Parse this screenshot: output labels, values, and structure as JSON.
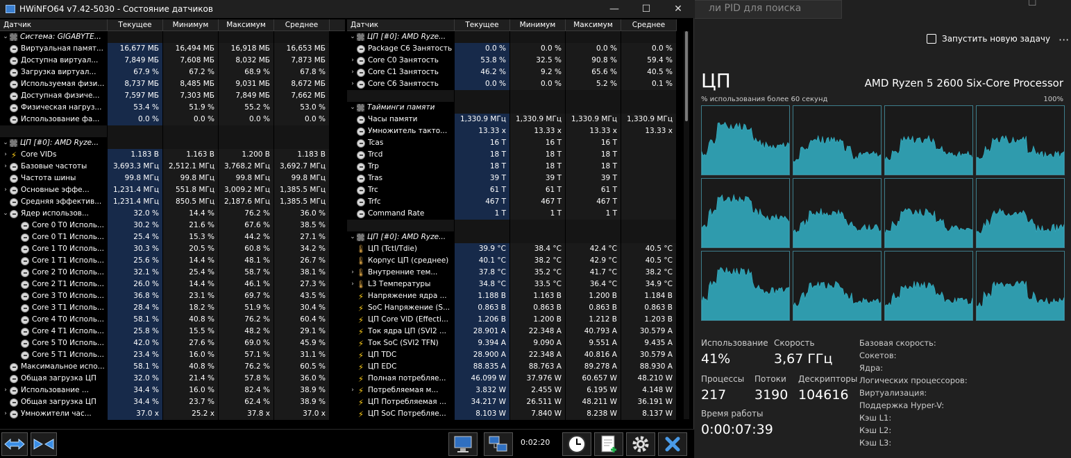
{
  "hwinfo": {
    "title": "HWiNFO64 v7.42-5030 - Состояние датчиков",
    "controls": {
      "minimize": "—",
      "maximize": "☐",
      "close": "✕"
    },
    "columns": [
      "Датчик",
      "Текущее",
      "Минимум",
      "Максимум",
      "Среднее"
    ],
    "left_rows": [
      {
        "kind": "group",
        "arrow": "v",
        "icon": "chip",
        "name": "Система: GIGABYTE...",
        "v": [
          "",
          "",
          "",
          ""
        ]
      },
      {
        "kind": "row",
        "arrow": "",
        "icon": "sensor",
        "indent": 0,
        "name": "Виртуальная памят...",
        "v": [
          "16,677 МБ",
          "16,494 МБ",
          "16,918 МБ",
          "16,653 МБ"
        ]
      },
      {
        "kind": "row",
        "arrow": "",
        "icon": "sensor",
        "indent": 0,
        "name": "Доступна виртуал...",
        "v": [
          "7,849 МБ",
          "7,608 МБ",
          "8,032 МБ",
          "7,873 МБ"
        ]
      },
      {
        "kind": "row",
        "arrow": "",
        "icon": "sensor",
        "indent": 0,
        "name": "Загрузка виртуал...",
        "v": [
          "67.9 %",
          "67.2 %",
          "68.9 %",
          "67.8 %"
        ]
      },
      {
        "kind": "row",
        "arrow": "",
        "icon": "sensor",
        "indent": 0,
        "name": "Используемая физи...",
        "v": [
          "8,737 МБ",
          "8,485 МБ",
          "9,031 МБ",
          "8,672 МБ"
        ]
      },
      {
        "kind": "row",
        "arrow": "",
        "icon": "sensor",
        "indent": 0,
        "name": "Доступная физиче...",
        "v": [
          "7,597 МБ",
          "7,303 МБ",
          "7,849 МБ",
          "7,662 МБ"
        ]
      },
      {
        "kind": "row",
        "arrow": "",
        "icon": "sensor",
        "indent": 0,
        "name": "Физическая нагруз...",
        "v": [
          "53.4 %",
          "51.9 %",
          "55.2 %",
          "53.0 %"
        ]
      },
      {
        "kind": "row",
        "arrow": "",
        "icon": "sensor",
        "indent": 0,
        "name": "Использование фа...",
        "v": [
          "0.0 %",
          "0.0 %",
          "0.0 %",
          "0.0 %"
        ]
      },
      {
        "kind": "sep"
      },
      {
        "kind": "group",
        "arrow": "v",
        "icon": "chip",
        "name": "ЦП [#0]: AMD Ryze...",
        "v": [
          "",
          "",
          "",
          ""
        ]
      },
      {
        "kind": "row",
        "arrow": ">",
        "icon": "bolt",
        "indent": 0,
        "name": "Core VIDs",
        "v": [
          "1.183 В",
          "1.163 В",
          "1.200 В",
          "1.183 В"
        ]
      },
      {
        "kind": "row",
        "arrow": ">",
        "icon": "sensor",
        "indent": 0,
        "name": "Базовые частоты",
        "v": [
          "3,693.3 МГц",
          "2,512.1 МГц",
          "3,768.2 МГц",
          "3,692.7 МГц"
        ]
      },
      {
        "kind": "row",
        "arrow": "",
        "icon": "sensor",
        "indent": 0,
        "name": "Частота шины",
        "v": [
          "99.8 МГц",
          "99.8 МГц",
          "99.8 МГц",
          "99.8 МГц"
        ]
      },
      {
        "kind": "row",
        "arrow": ">",
        "icon": "sensor",
        "indent": 0,
        "name": "Основные эффе...",
        "v": [
          "1,231.4 МГц",
          "551.8 МГц",
          "3,009.2 МГц",
          "1,385.5 МГц"
        ]
      },
      {
        "kind": "row",
        "arrow": "",
        "icon": "sensor",
        "indent": 0,
        "name": "Средняя эффектив...",
        "v": [
          "1,231.4 МГц",
          "850.5 МГц",
          "2,187.6 МГц",
          "1,385.5 МГц"
        ]
      },
      {
        "kind": "row",
        "arrow": "v",
        "icon": "sensor",
        "indent": 0,
        "name": "Ядер использов...",
        "v": [
          "32.0 %",
          "14.4 %",
          "76.2 %",
          "36.0 %"
        ]
      },
      {
        "kind": "row",
        "arrow": "",
        "icon": "sensor",
        "indent": 1,
        "name": "Core 0 T0 Исполь...",
        "v": [
          "30.2 %",
          "21.6 %",
          "67.6 %",
          "38.5 %"
        ]
      },
      {
        "kind": "row",
        "arrow": "",
        "icon": "sensor",
        "indent": 1,
        "name": "Core 0 T1 Исполь...",
        "v": [
          "25.4 %",
          "15.3 %",
          "44.2 %",
          "27.1 %"
        ]
      },
      {
        "kind": "row",
        "arrow": "",
        "icon": "sensor",
        "indent": 1,
        "name": "Core 1 T0 Исполь...",
        "v": [
          "30.3 %",
          "20.5 %",
          "60.8 %",
          "34.2 %"
        ]
      },
      {
        "kind": "row",
        "arrow": "",
        "icon": "sensor",
        "indent": 1,
        "name": "Core 1 T1 Исполь...",
        "v": [
          "25.6 %",
          "14.4 %",
          "48.1 %",
          "26.7 %"
        ]
      },
      {
        "kind": "row",
        "arrow": "",
        "icon": "sensor",
        "indent": 1,
        "name": "Core 2 T0 Исполь...",
        "v": [
          "32.1 %",
          "25.4 %",
          "58.7 %",
          "38.1 %"
        ]
      },
      {
        "kind": "row",
        "arrow": "",
        "icon": "sensor",
        "indent": 1,
        "name": "Core 2 T1 Исполь...",
        "v": [
          "26.0 %",
          "14.4 %",
          "46.1 %",
          "27.3 %"
        ]
      },
      {
        "kind": "row",
        "arrow": "",
        "icon": "sensor",
        "indent": 1,
        "name": "Core 3 T0 Исполь...",
        "v": [
          "36.8 %",
          "23.1 %",
          "69.7 %",
          "43.5 %"
        ]
      },
      {
        "kind": "row",
        "arrow": "",
        "icon": "sensor",
        "indent": 1,
        "name": "Core 3 T1 Исполь...",
        "v": [
          "28.4 %",
          "18.2 %",
          "51.9 %",
          "30.4 %"
        ]
      },
      {
        "kind": "row",
        "arrow": "",
        "icon": "sensor",
        "indent": 1,
        "name": "Core 4 T0 Исполь...",
        "v": [
          "58.1 %",
          "40.8 %",
          "76.2 %",
          "60.4 %"
        ]
      },
      {
        "kind": "row",
        "arrow": "",
        "icon": "sensor",
        "indent": 1,
        "name": "Core 4 T1 Исполь...",
        "v": [
          "25.8 %",
          "15.5 %",
          "48.2 %",
          "29.1 %"
        ]
      },
      {
        "kind": "row",
        "arrow": "",
        "icon": "sensor",
        "indent": 1,
        "name": "Core 5 T0 Исполь...",
        "v": [
          "42.0 %",
          "27.6 %",
          "69.0 %",
          "45.9 %"
        ]
      },
      {
        "kind": "row",
        "arrow": "",
        "icon": "sensor",
        "indent": 1,
        "name": "Core 5 T1 Исполь...",
        "v": [
          "23.4 %",
          "16.0 %",
          "57.1 %",
          "31.1 %"
        ]
      },
      {
        "kind": "row",
        "arrow": "",
        "icon": "sensor",
        "indent": 0,
        "name": "Максимальное испо...",
        "v": [
          "58.1 %",
          "40.8 %",
          "76.2 %",
          "60.5 %"
        ]
      },
      {
        "kind": "row",
        "arrow": "",
        "icon": "sensor",
        "indent": 0,
        "name": "Общая загрузка ЦП",
        "v": [
          "32.0 %",
          "21.4 %",
          "57.8 %",
          "36.0 %"
        ]
      },
      {
        "kind": "row",
        "arrow": ">",
        "icon": "sensor",
        "indent": 0,
        "name": "Использование ...",
        "v": [
          "34.4 %",
          "16.0 %",
          "82.4 %",
          "38.9 %"
        ]
      },
      {
        "kind": "row",
        "arrow": "",
        "icon": "sensor",
        "indent": 0,
        "name": "Общая загрузка ЦП",
        "v": [
          "34.4 %",
          "23.7 %",
          "62.4 %",
          "38.9 %"
        ]
      },
      {
        "kind": "row",
        "arrow": ">",
        "icon": "sensor",
        "indent": 0,
        "name": "Умножители час...",
        "v": [
          "37.0 x",
          "25.2 x",
          "37.8 x",
          "37.0 x"
        ]
      }
    ],
    "right_rows": [
      {
        "kind": "group",
        "arrow": "v",
        "icon": "chip",
        "name": "ЦП [#0]: AMD Ryze...",
        "v": [
          "",
          "",
          "",
          ""
        ]
      },
      {
        "kind": "row",
        "arrow": "",
        "icon": "sensor",
        "indent": 0,
        "name": "Package C6 Занятость",
        "v": [
          "0.0 %",
          "0.0 %",
          "0.0 %",
          "0.0 %"
        ]
      },
      {
        "kind": "row",
        "arrow": ">",
        "icon": "sensor",
        "indent": 0,
        "name": "Core C0 Занятость",
        "v": [
          "53.8 %",
          "32.5 %",
          "90.8 %",
          "59.4 %"
        ]
      },
      {
        "kind": "row",
        "arrow": ">",
        "icon": "sensor",
        "indent": 0,
        "name": "Core C1 Занятость",
        "v": [
          "46.2 %",
          "9.2 %",
          "65.6 %",
          "40.5 %"
        ]
      },
      {
        "kind": "row",
        "arrow": ">",
        "icon": "sensor",
        "indent": 0,
        "name": "Core C6 Занятость",
        "v": [
          "0.0 %",
          "0.0 %",
          "5.2 %",
          "0.1 %"
        ]
      },
      {
        "kind": "sep"
      },
      {
        "kind": "group",
        "arrow": "v",
        "icon": "chip",
        "name": "Тайминги памяти",
        "v": [
          "",
          "",
          "",
          ""
        ]
      },
      {
        "kind": "row",
        "arrow": "",
        "icon": "sensor",
        "indent": 0,
        "name": "Часы памяти",
        "v": [
          "1,330.9 МГц",
          "1,330.9 МГц",
          "1,330.9 МГц",
          "1,330.9 МГц"
        ]
      },
      {
        "kind": "row",
        "arrow": "",
        "icon": "sensor",
        "indent": 0,
        "name": "Умножитель такто...",
        "v": [
          "13.33 x",
          "13.33 x",
          "13.33 x",
          "13.33 x"
        ]
      },
      {
        "kind": "row",
        "arrow": "",
        "icon": "sensor",
        "indent": 0,
        "name": "Tcas",
        "v": [
          "16 T",
          "16 T",
          "16 T",
          ""
        ]
      },
      {
        "kind": "row",
        "arrow": "",
        "icon": "sensor",
        "indent": 0,
        "name": "Trcd",
        "v": [
          "18 T",
          "18 T",
          "18 T",
          ""
        ]
      },
      {
        "kind": "row",
        "arrow": "",
        "icon": "sensor",
        "indent": 0,
        "name": "Trp",
        "v": [
          "18 T",
          "18 T",
          "18 T",
          ""
        ]
      },
      {
        "kind": "row",
        "arrow": "",
        "icon": "sensor",
        "indent": 0,
        "name": "Tras",
        "v": [
          "39 T",
          "39 T",
          "39 T",
          ""
        ]
      },
      {
        "kind": "row",
        "arrow": "",
        "icon": "sensor",
        "indent": 0,
        "name": "Trc",
        "v": [
          "61 T",
          "61 T",
          "61 T",
          ""
        ]
      },
      {
        "kind": "row",
        "arrow": "",
        "icon": "sensor",
        "indent": 0,
        "name": "Trfc",
        "v": [
          "467 T",
          "467 T",
          "467 T",
          ""
        ]
      },
      {
        "kind": "row",
        "arrow": "",
        "icon": "sensor",
        "indent": 0,
        "name": "Command Rate",
        "v": [
          "1 T",
          "1 T",
          "1 T",
          ""
        ]
      },
      {
        "kind": "sep"
      },
      {
        "kind": "group",
        "arrow": "v",
        "icon": "chip",
        "name": "ЦП [#0]: AMD Ryze...",
        "v": [
          "",
          "",
          "",
          ""
        ]
      },
      {
        "kind": "row",
        "arrow": "",
        "icon": "therm",
        "indent": 0,
        "name": "ЦП (Tctl/Tdie)",
        "v": [
          "39.9 °C",
          "38.4 °C",
          "42.4 °C",
          "40.5 °C"
        ]
      },
      {
        "kind": "row",
        "arrow": "",
        "icon": "therm",
        "indent": 0,
        "name": "Корпус ЦП (среднее)",
        "v": [
          "40.1 °C",
          "38.2 °C",
          "42.9 °C",
          "40.5 °C"
        ]
      },
      {
        "kind": "row",
        "arrow": ">",
        "icon": "therm",
        "indent": 0,
        "name": "Внутренние тем...",
        "v": [
          "37.8 °C",
          "35.2 °C",
          "41.7 °C",
          "38.2 °C"
        ]
      },
      {
        "kind": "row",
        "arrow": ">",
        "icon": "therm",
        "indent": 0,
        "name": "L3 Температуры",
        "v": [
          "34.8 °C",
          "33.5 °C",
          "36.4 °C",
          "34.9 °C"
        ]
      },
      {
        "kind": "row",
        "arrow": "",
        "icon": "bolt",
        "indent": 0,
        "name": "Напряжение ядра ...",
        "v": [
          "1.188 В",
          "1.163 В",
          "1.200 В",
          "1.184 В"
        ]
      },
      {
        "kind": "row",
        "arrow": "",
        "icon": "bolt",
        "indent": 0,
        "name": "SoC Напряжение (S...",
        "v": [
          "0.863 В",
          "0.863 В",
          "0.863 В",
          "0.863 В"
        ]
      },
      {
        "kind": "row",
        "arrow": "",
        "icon": "bolt",
        "indent": 0,
        "name": "ЦП Core VID (Effecti...",
        "v": [
          "1.206 В",
          "1.200 В",
          "1.212 В",
          "1.203 В"
        ]
      },
      {
        "kind": "row",
        "arrow": "",
        "icon": "bolt",
        "indent": 0,
        "name": "Ток ядра ЦП (SVI2 ...",
        "v": [
          "28.901 А",
          "22.348 А",
          "40.793 А",
          "30.579 А"
        ]
      },
      {
        "kind": "row",
        "arrow": "",
        "icon": "bolt",
        "indent": 0,
        "name": "Ток SoC (SVI2 TFN)",
        "v": [
          "9.394 А",
          "9.090 А",
          "9.551 А",
          "9.435 А"
        ]
      },
      {
        "kind": "row",
        "arrow": "",
        "icon": "bolt",
        "indent": 0,
        "name": "ЦП TDC",
        "v": [
          "28.900 А",
          "22.348 А",
          "40.816 А",
          "30.579 А"
        ]
      },
      {
        "kind": "row",
        "arrow": "",
        "icon": "bolt",
        "indent": 0,
        "name": "ЦП EDC",
        "v": [
          "88.835 А",
          "88.763 А",
          "89.278 А",
          "88.930 А"
        ]
      },
      {
        "kind": "row",
        "arrow": "",
        "icon": "bolt",
        "indent": 0,
        "name": "Полная потребляе...",
        "v": [
          "46.099 W",
          "37.976 W",
          "60.657 W",
          "48.210 W"
        ]
      },
      {
        "kind": "row",
        "arrow": ">",
        "icon": "bolt",
        "indent": 0,
        "name": "Потребляемая м...",
        "v": [
          "3.832 W",
          "2.455 W",
          "6.195 W",
          "4.148 W"
        ]
      },
      {
        "kind": "row",
        "arrow": "",
        "icon": "bolt",
        "indent": 0,
        "name": "ЦП Потребляемая ...",
        "v": [
          "34.217 W",
          "26.511 W",
          "48.211 W",
          "36.191 W"
        ]
      },
      {
        "kind": "row",
        "arrow": "",
        "icon": "bolt",
        "indent": 0,
        "name": "ЦП SoC Потребляе...",
        "v": [
          "8.103 W",
          "7.840 W",
          "8.238 W",
          "8.137 W"
        ]
      }
    ],
    "timer": "0:02:20",
    "bottom_buttons": [
      "nav-arrows-icon",
      "collapse-arrows-icon",
      "monitor-icon",
      "network-icon",
      "clock-icon",
      "report-add-icon",
      "settings-gear-icon",
      "close-x-icon"
    ]
  },
  "taskmgr": {
    "search_placeholder": "ли PID для поиска",
    "run_task": "Запустить новую задачу",
    "more": "···",
    "cpu_heading": "ЦП",
    "cpu_model": "AMD Ryzen 5 2600 Six-Core Processor",
    "graph_label": "% использования более 60 секунд",
    "graph_max": "100%",
    "stats": {
      "usage_label": "Использование",
      "usage_value": "41%",
      "speed_label": "Скорость",
      "speed_value": "3,67 ГГц",
      "processes_label": "Процессы",
      "processes_value": "217",
      "threads_label": "Потоки",
      "threads_value": "3190",
      "handles_label": "Дескрипторы",
      "handles_value": "104616",
      "uptime_label": "Время работы",
      "uptime_value": "0:00:07:39"
    },
    "info_labels": [
      "Базовая скорость:",
      "Сокетов:",
      "Ядра:",
      "Логических процессоров:",
      "Виртуализация:",
      "Поддержка Hyper-V:",
      "Кэш L1:",
      "Кэш L2:",
      "Кэш L3:"
    ],
    "accent_color": "#34b3c8",
    "graph_border_color": "#3d7e8c"
  }
}
